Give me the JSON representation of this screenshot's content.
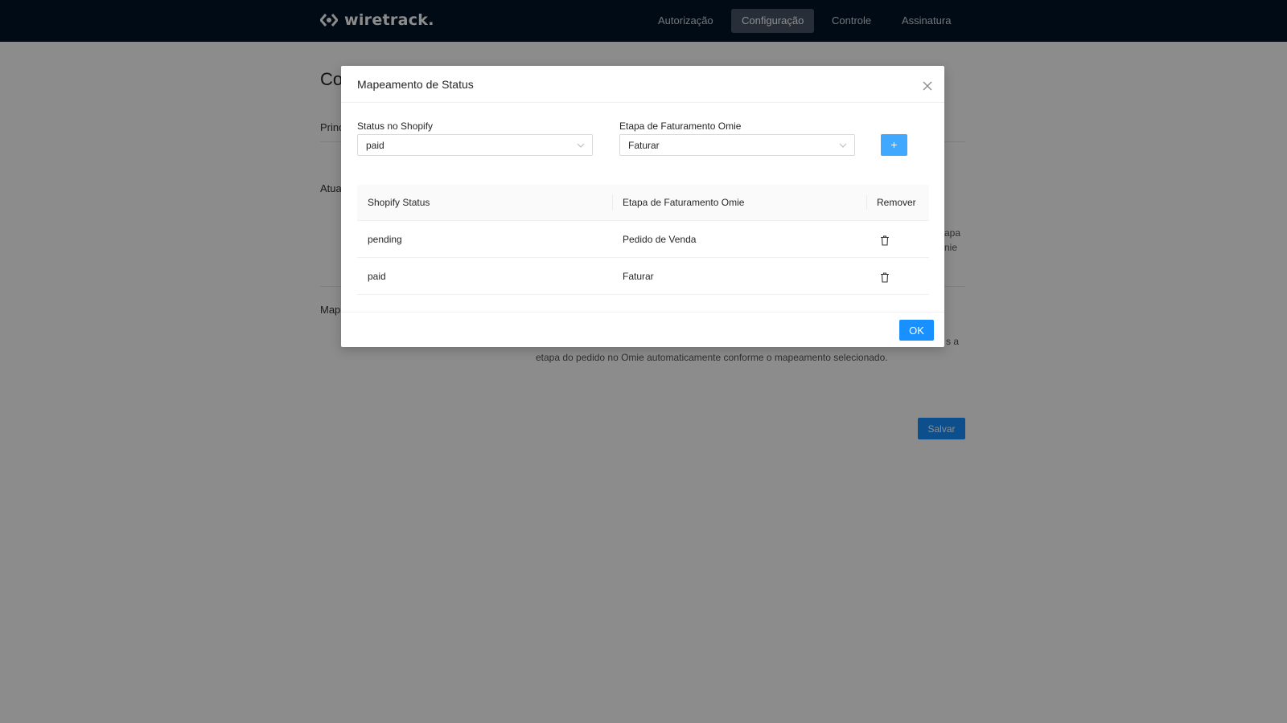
{
  "header": {
    "logo_text": "wiretrack.",
    "nav": [
      {
        "label": "Autorização",
        "active": false
      },
      {
        "label": "Configuração",
        "active": true
      },
      {
        "label": "Controle",
        "active": false
      },
      {
        "label": "Assinatura",
        "active": false
      }
    ]
  },
  "page": {
    "title_fragment": "Co",
    "section_principal": "Princ",
    "section_atualizacao": "Atua",
    "section_mapeamento": "Map",
    "desc_line1_right": "apa",
    "desc_line2_right": "nie",
    "desc_tail_right": "s a",
    "desc_last_line": "etapa do pedido no Omie automaticamente conforme o mapeamento selecionado.",
    "save_label": "Salvar"
  },
  "modal": {
    "title": "Mapeamento de Status",
    "shopify_status_label": "Status no Shopify",
    "shopify_status_value": "paid",
    "omie_stage_label": "Etapa de Faturamento Omie",
    "omie_stage_value": "Faturar",
    "add_label": "+",
    "table": {
      "columns": [
        "Shopify Status",
        "Etapa de Faturamento Omie",
        "Remover"
      ],
      "rows": [
        {
          "shopify_status": "pending",
          "omie_stage": "Pedido de Venda"
        },
        {
          "shopify_status": "paid",
          "omie_stage": "Faturar"
        }
      ]
    },
    "ok_label": "OK"
  },
  "colors": {
    "header_bg": "#001529",
    "primary": "#1890ff",
    "overlay": "rgba(0,0,0,0.45)"
  }
}
